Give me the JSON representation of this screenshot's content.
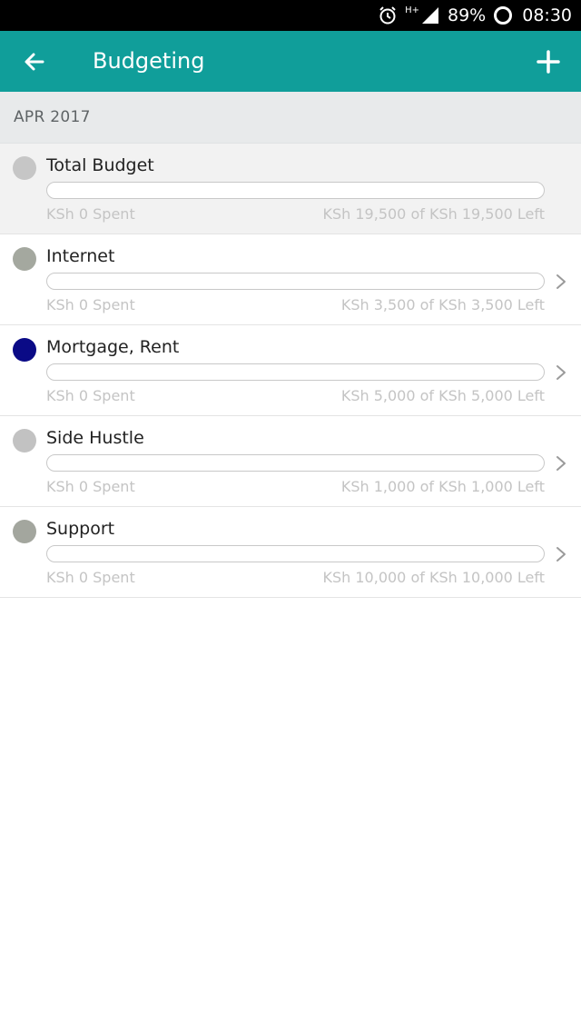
{
  "status_bar": {
    "signal_label": "H+",
    "battery": "89%",
    "time": "08:30"
  },
  "app_bar": {
    "title": "Budgeting"
  },
  "month": "APR 2017",
  "budgets": [
    {
      "name": "Total Budget",
      "color": "#c6c6c6",
      "spent": "KSh 0 Spent",
      "left": "KSh 19,500 of KSh 19,500 Left",
      "progress": 0,
      "has_chevron": false
    },
    {
      "name": "Internet",
      "color": "#a4a89f",
      "spent": "KSh 0 Spent",
      "left": "KSh 3,500 of KSh 3,500 Left",
      "progress": 0,
      "has_chevron": true
    },
    {
      "name": "Mortgage, Rent",
      "color": "#0a0a86",
      "spent": "KSh 0 Spent",
      "left": "KSh 5,000 of KSh 5,000 Left",
      "progress": 0,
      "has_chevron": true
    },
    {
      "name": "Side Hustle",
      "color": "#c2c2c2",
      "spent": "KSh 0 Spent",
      "left": "KSh 1,000 of KSh 1,000 Left",
      "progress": 0,
      "has_chevron": true
    },
    {
      "name": "Support",
      "color": "#a3a69e",
      "spent": "KSh 0 Spent",
      "left": "KSh 10,000 of KSh 10,000 Left",
      "progress": 0,
      "has_chevron": true
    }
  ],
  "colors": {
    "accent": "#109e9a",
    "status_bar": "#000000",
    "month_header_bg": "#e8eaeb"
  },
  "icons": {
    "back": "arrow-left-icon",
    "add": "plus-icon",
    "alarm": "alarm-icon",
    "signal": "signal-icon",
    "battery": "battery-ring-icon",
    "chevron": "chevron-right-icon"
  }
}
